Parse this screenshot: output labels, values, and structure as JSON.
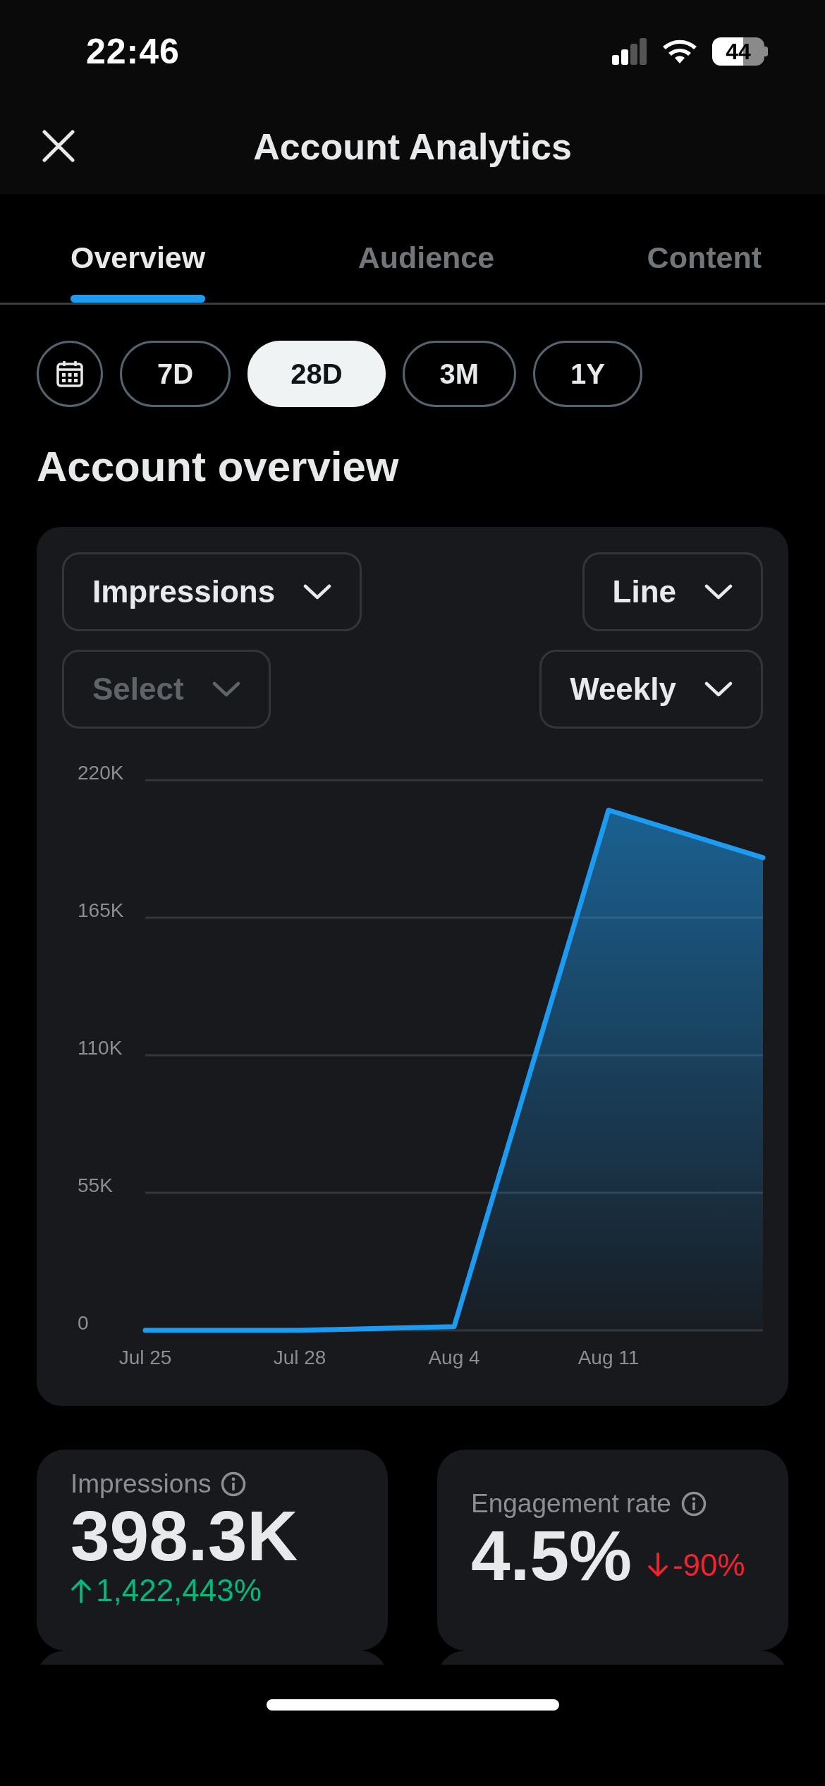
{
  "status_bar": {
    "time": "22:46",
    "battery": "44"
  },
  "header": {
    "title": "Account Analytics"
  },
  "tabs": [
    {
      "label": "Overview",
      "selected": true
    },
    {
      "label": "Audience",
      "selected": false
    },
    {
      "label": "Content",
      "selected": false
    }
  ],
  "ranges": [
    {
      "label": "7D",
      "selected": false
    },
    {
      "label": "28D",
      "selected": true
    },
    {
      "label": "3M",
      "selected": false
    },
    {
      "label": "1Y",
      "selected": false
    }
  ],
  "section_title": "Account overview",
  "overview": {
    "controls": [
      {
        "label": "Impressions",
        "disabled": false
      },
      {
        "label": "Line",
        "disabled": false
      },
      {
        "label": "Select",
        "disabled": true
      },
      {
        "label": "Weekly",
        "disabled": false
      }
    ],
    "chart_data": {
      "type": "area",
      "grid": true,
      "categories": [
        "Jul 25",
        "Jul 28",
        "Aug 4",
        "Aug 11",
        null
      ],
      "ylim": [
        0,
        220000
      ],
      "yticks": [
        {
          "value": 0,
          "label": "0"
        },
        {
          "value": 55000,
          "label": "55K"
        },
        {
          "value": 110000,
          "label": "110K"
        },
        {
          "value": 165000,
          "label": "165K"
        },
        {
          "value": 220000,
          "label": "220K"
        }
      ],
      "series": [
        {
          "color": "#1d9bf0",
          "values": [
            0,
            0,
            1500,
            208000,
            189000
          ]
        }
      ]
    }
  },
  "stats": [
    {
      "kind": "stacked",
      "label": "Impressions",
      "value": "398.3K",
      "increase": true,
      "change": "1,422,443%"
    },
    {
      "kind": "inline",
      "label": "Engagement rate",
      "value": "4.5%",
      "increase": false,
      "change": "-90%"
    }
  ]
}
